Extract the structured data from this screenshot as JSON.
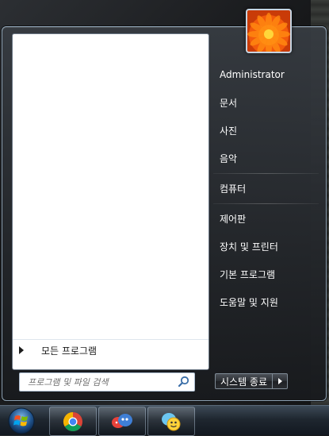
{
  "start_menu": {
    "all_programs_label": "모든 프로그램",
    "search_placeholder": "프로그램 및 파일 검색",
    "right_items": [
      "Administrator",
      "문서",
      "사진",
      "음악",
      "컴퓨터",
      "제어판",
      "장치 및 프린터",
      "기본 프로그램",
      "도움말 및 지원"
    ],
    "shutdown_label": "시스템 종료"
  },
  "icons": {
    "user_picture": "flower-avatar",
    "search": "magnifier-icon",
    "start": "windows-orb-icon",
    "taskbar": [
      "chrome-icon",
      "messenger-icon",
      "chat-bubble-icon"
    ]
  },
  "colors": {
    "menu_border": "#8fa3b5",
    "menu_text": "#ffffff",
    "left_pane_bg": "#ffffff",
    "taskbar_top": "#3d4a57"
  }
}
